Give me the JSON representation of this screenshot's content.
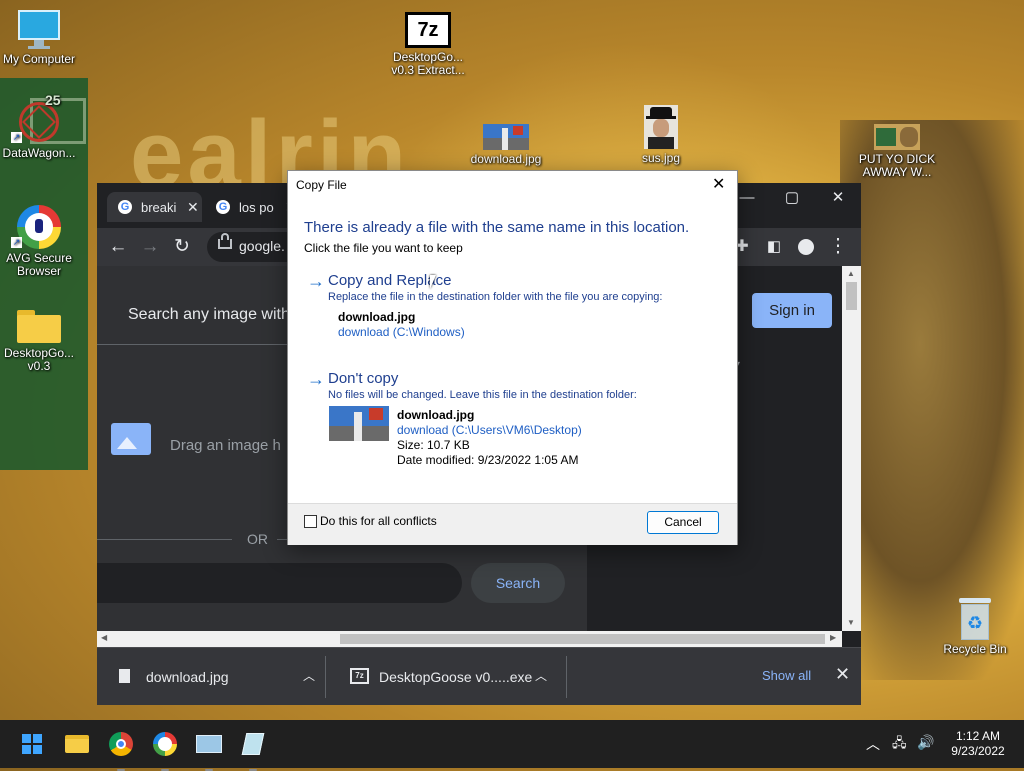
{
  "desktop": {
    "icons": [
      {
        "label": "My Computer"
      },
      {
        "label": "DataWagon..."
      },
      {
        "label": "AVG Secure Browser"
      },
      {
        "label": "DesktopGo... v0.3"
      },
      {
        "label": "DesktopGo... v0.3 Extract..."
      },
      {
        "label": "download.jpg"
      },
      {
        "label": "sus.jpg"
      },
      {
        "label": "PUT YO DICK AWWAY W..."
      },
      {
        "label": "Recycle Bin"
      }
    ],
    "wallpaper_text": "ealrin",
    "zip_glyph": "7z",
    "green_number": "25"
  },
  "chrome": {
    "tabs": [
      {
        "title": "breaki"
      },
      {
        "title": "los po"
      }
    ],
    "address": "google.",
    "page": {
      "heading": "Search any image with",
      "drop_text": "Drag an image h",
      "or_label": "OR",
      "search_button": "Search",
      "sign_in": "Sign in"
    },
    "downloads": [
      {
        "name": "download.jpg"
      },
      {
        "name": "DesktopGoose v0.....exe"
      }
    ],
    "show_all": "Show all"
  },
  "dialog": {
    "title": "Copy File",
    "heading": "There is already a file with the same name in this location.",
    "subheading": "Click the file you want to keep",
    "replace": {
      "title": "Copy and Replace",
      "description": "Replace the file in the destination folder with the file you are copying:",
      "file_name": "download.jpg",
      "file_path": "download (C:\\Windows)"
    },
    "dont_copy": {
      "title": "Don't copy",
      "description": "No files will be changed. Leave this file in the destination folder:",
      "file_name": "download.jpg",
      "file_path": "download (C:\\Users\\VM6\\Desktop)",
      "size": "Size: 10.7 KB",
      "date_modified": "Date modified: 9/23/2022 1:05 AM"
    },
    "checkbox_label": "Do this for all conflicts",
    "cancel": "Cancel"
  },
  "taskbar": {
    "time": "1:12 AM",
    "date": "9/23/2022"
  },
  "colors": {
    "accent": "#0078d4",
    "dialog_link": "#1f3f8f",
    "chrome_dark": "#202124",
    "chrome_blue": "#8ab4f8"
  }
}
